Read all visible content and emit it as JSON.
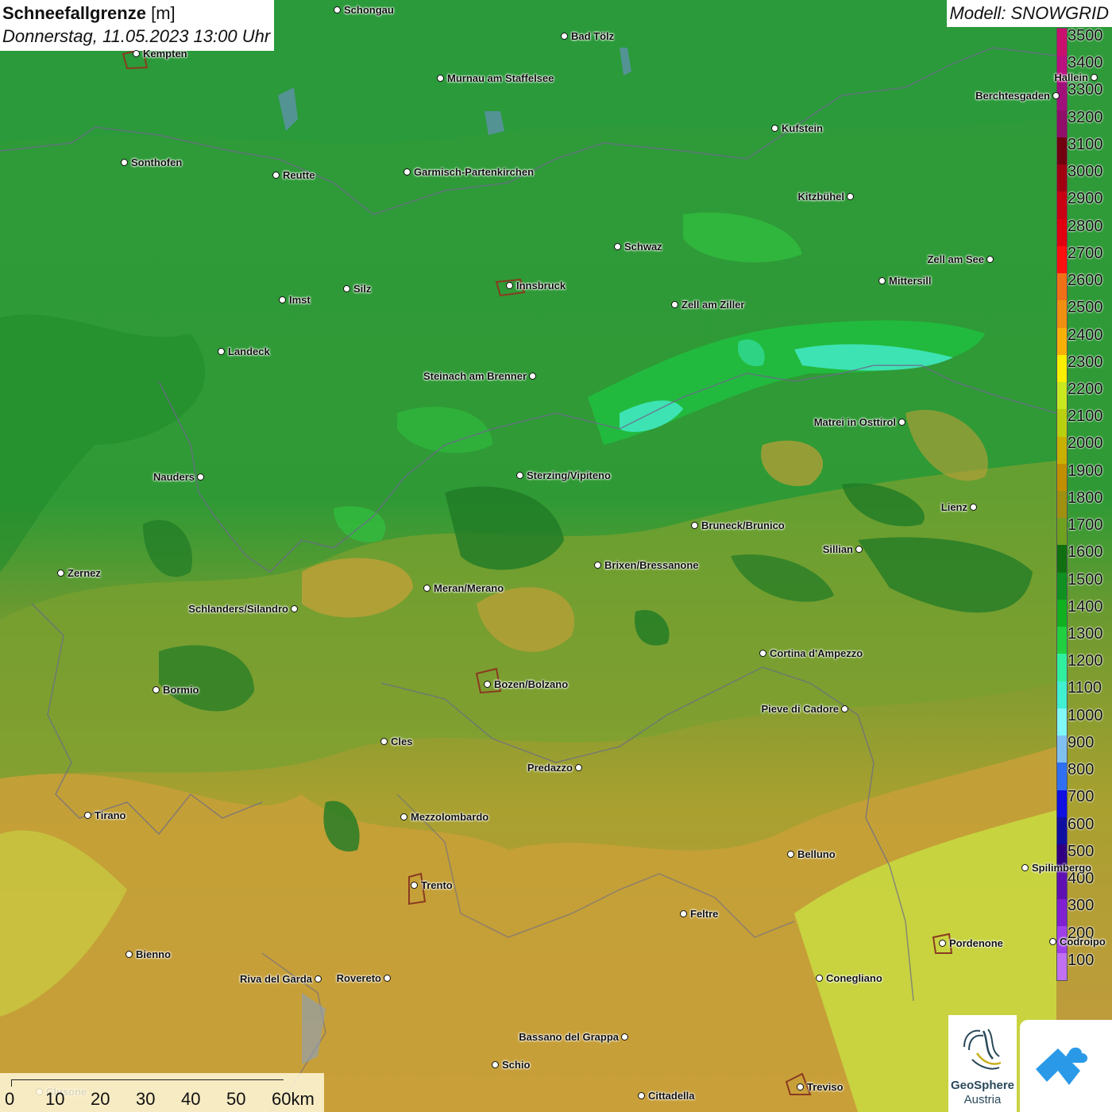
{
  "title": {
    "main": "Schneefallgrenze",
    "unit": "[m]",
    "datetime": "Donnerstag, 11.05.2023 13:00 Uhr"
  },
  "model": "Modell: SNOWGRID",
  "legend": {
    "levels": [
      "3500",
      "3400",
      "3300",
      "3200",
      "3100",
      "3000",
      "2900",
      "2800",
      "2700",
      "2600",
      "2500",
      "2400",
      "2300",
      "2200",
      "2100",
      "2000",
      "1900",
      "1800",
      "1700",
      "1600",
      "1500",
      "1400",
      "1300",
      "1200",
      "1100",
      "1000",
      "900",
      "800",
      "700",
      "600",
      "500",
      "400",
      "300",
      "200",
      "100"
    ],
    "colors": [
      "#c8106e",
      "#b8107e",
      "#a0107a",
      "#900f6a",
      "#700010",
      "#a00012",
      "#c80014",
      "#e00010",
      "#ff1010",
      "#f07018",
      "#f09010",
      "#f8b008",
      "#f8f000",
      "#c8e820",
      "#b8d010",
      "#c8b000",
      "#c09000",
      "#a09010",
      "#70a020",
      "#107010",
      "#109020",
      "#10b020",
      "#20d040",
      "#30f0a0",
      "#40f0d0",
      "#80f8f8",
      "#80c0f0",
      "#3070f0",
      "#1010e0",
      "#1010a0",
      "#300080",
      "#6010b0",
      "#8020d0",
      "#a040e8",
      "#c070f0"
    ]
  },
  "cities": [
    {
      "name": "Schongau"
    },
    {
      "name": "Bad Tölz"
    },
    {
      "name": "Kempten"
    },
    {
      "name": "Murnau am Staffelsee"
    },
    {
      "name": "Hallein"
    },
    {
      "name": "Berchtesgaden"
    },
    {
      "name": "Kufstein"
    },
    {
      "name": "Sonthofen"
    },
    {
      "name": "Reutte"
    },
    {
      "name": "Garmisch-Partenkirchen"
    },
    {
      "name": "Kitzbühel"
    },
    {
      "name": "Schwaz"
    },
    {
      "name": "Zell am See"
    },
    {
      "name": "Mittersill"
    },
    {
      "name": "Innsbruck"
    },
    {
      "name": "Silz"
    },
    {
      "name": "Imst"
    },
    {
      "name": "Zell am Ziller"
    },
    {
      "name": "Landeck"
    },
    {
      "name": "Steinach am Brenner"
    },
    {
      "name": "Matrei in Osttirol"
    },
    {
      "name": "Nauders"
    },
    {
      "name": "Sterzing/Vipiteno"
    },
    {
      "name": "Lienz"
    },
    {
      "name": "Bruneck/Brunico"
    },
    {
      "name": "Sillian"
    },
    {
      "name": "Zernez"
    },
    {
      "name": "Brixen/Bressanone"
    },
    {
      "name": "Meran/Merano"
    },
    {
      "name": "Schlanders/Silandro"
    },
    {
      "name": "Cortina d'Ampezzo"
    },
    {
      "name": "Bozen/Bolzano"
    },
    {
      "name": "Bormio"
    },
    {
      "name": "Pieve di Cadore"
    },
    {
      "name": "Cles"
    },
    {
      "name": "Predazzo"
    },
    {
      "name": "Tirano"
    },
    {
      "name": "Mezzolombardo"
    },
    {
      "name": "Belluno"
    },
    {
      "name": "Spilimbergo"
    },
    {
      "name": "Trento"
    },
    {
      "name": "Feltre"
    },
    {
      "name": "Pordenone"
    },
    {
      "name": "Bienno"
    },
    {
      "name": "Riva del Garda"
    },
    {
      "name": "Rovereto"
    },
    {
      "name": "Conegliano"
    },
    {
      "name": "Bassano del Grappa"
    },
    {
      "name": "Schio"
    },
    {
      "name": "Treviso"
    },
    {
      "name": "Cittadella"
    },
    {
      "name": "Codroipo"
    },
    {
      "name": "Clusone"
    }
  ],
  "scalebar": {
    "labels": [
      "0",
      "10",
      "20",
      "30",
      "40",
      "50",
      "60km"
    ]
  },
  "logos": {
    "geosphere_line1": "GeoSphere",
    "geosphere_line2": "Austria"
  }
}
